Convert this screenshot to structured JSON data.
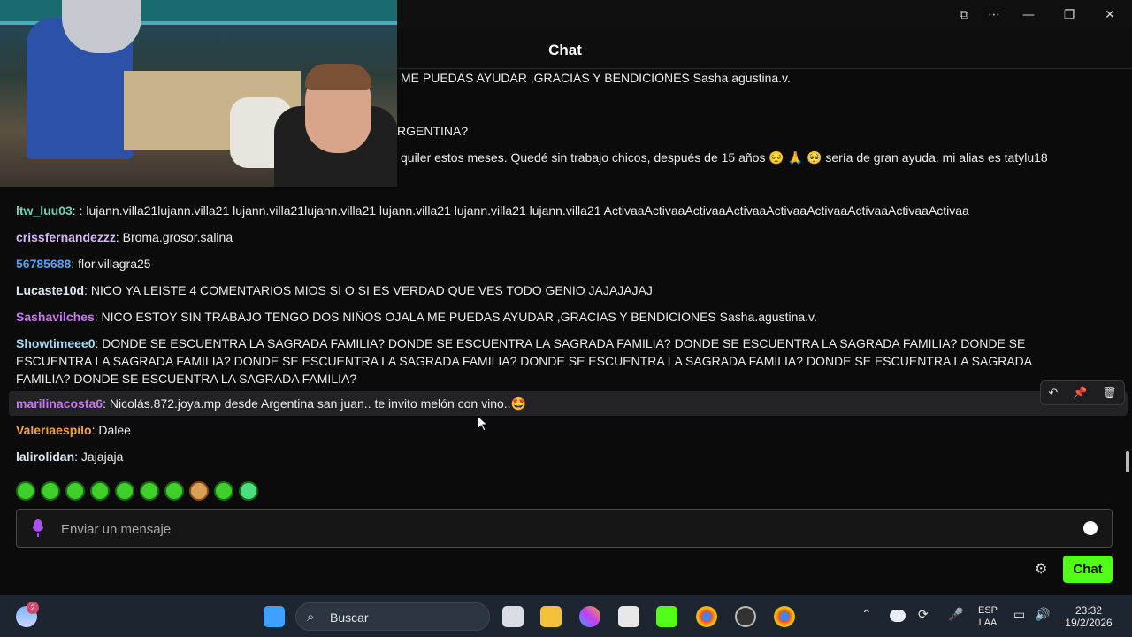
{
  "window": {
    "title": "Chat",
    "controls": [
      "screen-icon",
      "more-icon",
      "minimize-icon",
      "restore-icon",
      "close-icon"
    ]
  },
  "messages_partial": [
    {
      "text": "ME PUEDAS AYUDAR ,GRACIAS Y BENDICIONES Sasha.agustina.v."
    },
    {
      "text": "RGENTINA?"
    },
    {
      "text": "quiler estos meses. Quedé sin trabajo chicos, después de 15 años 😔 🙏 🥺  sería de gran ayuda. mi alias es tatylu18"
    }
  ],
  "messages": [
    {
      "user": "ltw_luu03",
      "color": "#6ad4b0",
      "text": " : lujann.villa21lujann.villa21 lujann.villa21lujann.villa21 lujann.villa21 lujann.villa21 lujann.villa21 ActivaaActivaaActivaaActivaaActivaaActivaaActivaaActivaaActivaa"
    },
    {
      "user": "crissfernandezzz",
      "color": "#d6b6f5",
      "text": " Broma.grosor.salina"
    },
    {
      "user": "56785688",
      "color": "#5aa0f0",
      "text": " flor.villagra25"
    },
    {
      "user": "Lucaste10d",
      "color": "#dfe7f5",
      "text": " NICO YA LEISTE 4 COMENTARIOS MIOS SI O SI ES VERDAD QUE VES TODO GENIO JAJAJAJAJ"
    },
    {
      "user": "Sashavilches",
      "color": "#c576f2",
      "text": " NICO ESTOY SIN TRABAJO TENGO DOS NIÑOS OJALA ME PUEDAS AYUDAR ,GRACIAS Y BENDICIONES Sasha.agustina.v."
    },
    {
      "user": "Showtimeee0",
      "color": "#a8d8f0",
      "text": " DONDE SE ESCUENTRA LA SAGRADA FAMILIA? DONDE SE ESCUENTRA LA SAGRADA FAMILIA? DONDE SE ESCUENTRA LA SAGRADA FAMILIA? DONDE SE ESCUENTRA LA SAGRADA FAMILIA? DONDE SE ESCUENTRA LA SAGRADA FAMILIA? DONDE SE ESCUENTRA LA SAGRADA FAMILIA? DONDE SE ESCUENTRA LA SAGRADA FAMILIA? DONDE SE ESCUENTRA LA SAGRADA FAMILIA?"
    },
    {
      "user": "marilinacosta6",
      "color": "#c576f2",
      "text": " Nicolás.872.joya.mp desde Argentina san juan.. te invito melón con vino..🤩"
    },
    {
      "user": "Valeriaespilo",
      "color": "#f0a040",
      "text": " Dalee"
    },
    {
      "user": "lalirolidan",
      "color": "#dfe7f5",
      "text": " Jajajaja"
    }
  ],
  "message_actions": [
    "reply-icon",
    "pin-icon",
    "delete-icon"
  ],
  "input": {
    "placeholder": "Enviar un mensaje"
  },
  "send_button": "Chat",
  "accent_color": "#53fc18",
  "taskbar": {
    "weather_badge": "2",
    "search_label": "Buscar",
    "lang_top": "ESP",
    "lang_bottom": "LAA",
    "time": "23:32",
    "date": "19/2/2026"
  }
}
